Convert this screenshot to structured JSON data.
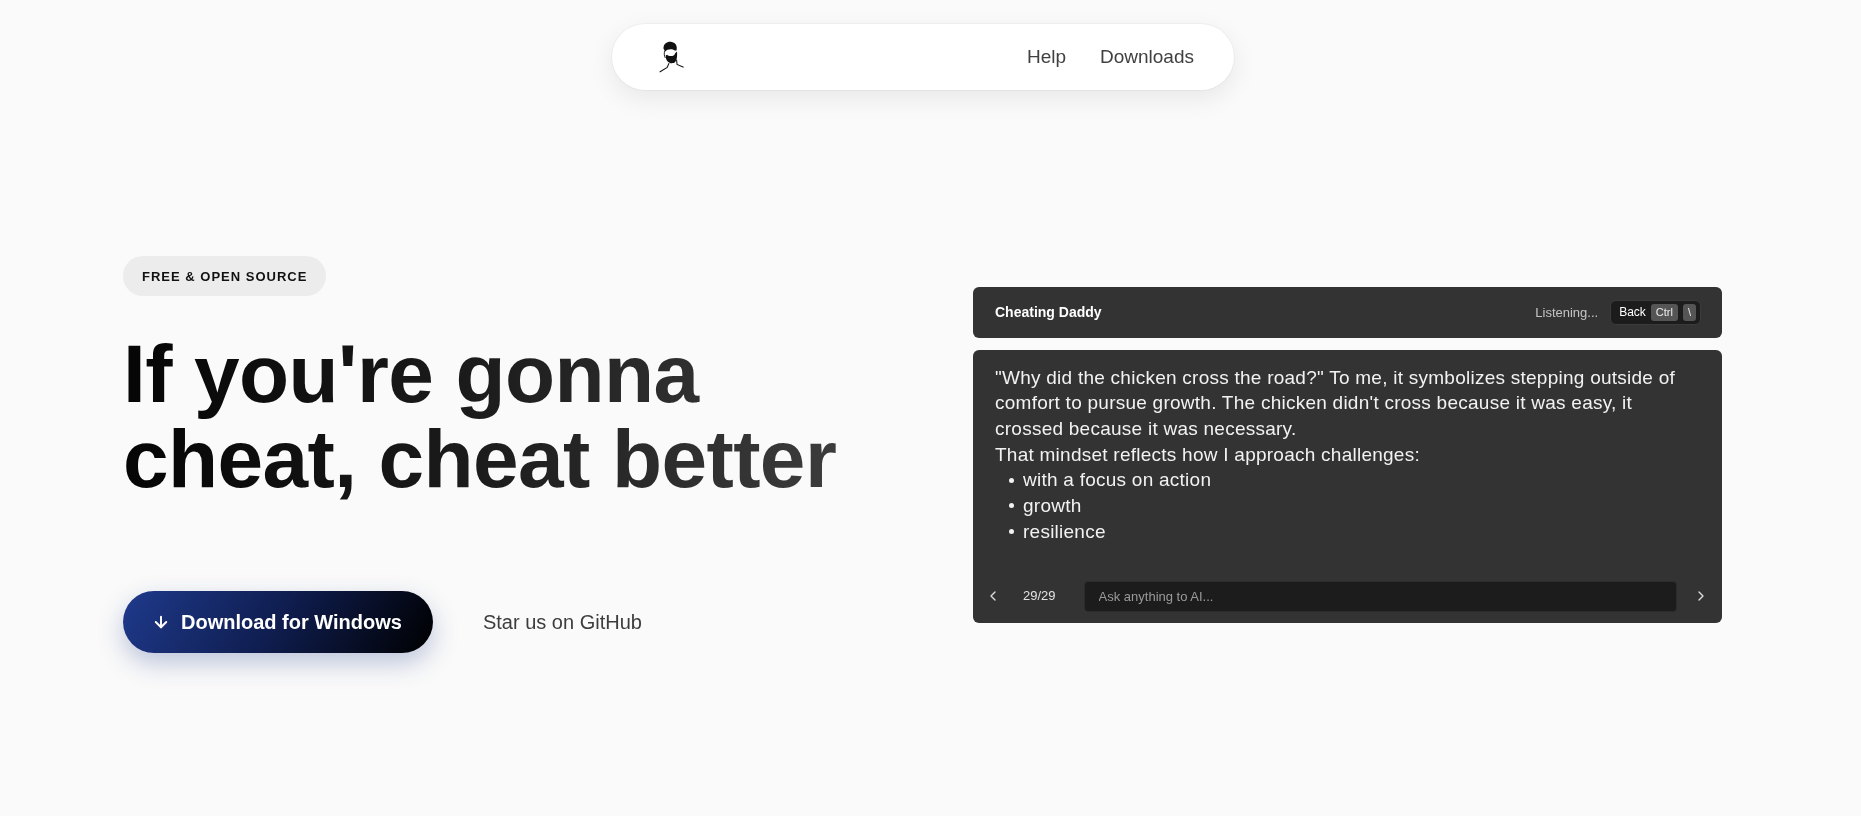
{
  "nav": {
    "links": [
      "Help",
      "Downloads"
    ]
  },
  "hero": {
    "badge": "FREE & OPEN SOURCE",
    "headline": [
      "If you're gonna",
      "cheat, cheat better"
    ],
    "primary_button": "Download for Windows",
    "secondary_link": "Star us on GitHub"
  },
  "app_preview": {
    "title": "Cheating Daddy",
    "status": "Listening...",
    "back_button": {
      "label": "Back",
      "keys": [
        "Ctrl",
        "\\"
      ]
    },
    "response": {
      "paragraphs": [
        "\"Why did the chicken cross the road?\" To me, it symbolizes stepping outside of comfort to pursue growth. The chicken didn't cross because it was easy, it crossed because it was necessary.",
        "That mindset reflects how I approach challenges:"
      ],
      "bullets": [
        "with a focus on action",
        "growth",
        "resilience"
      ]
    },
    "counter": "29/29",
    "input": {
      "placeholder": "Ask anything to AI..."
    }
  }
}
